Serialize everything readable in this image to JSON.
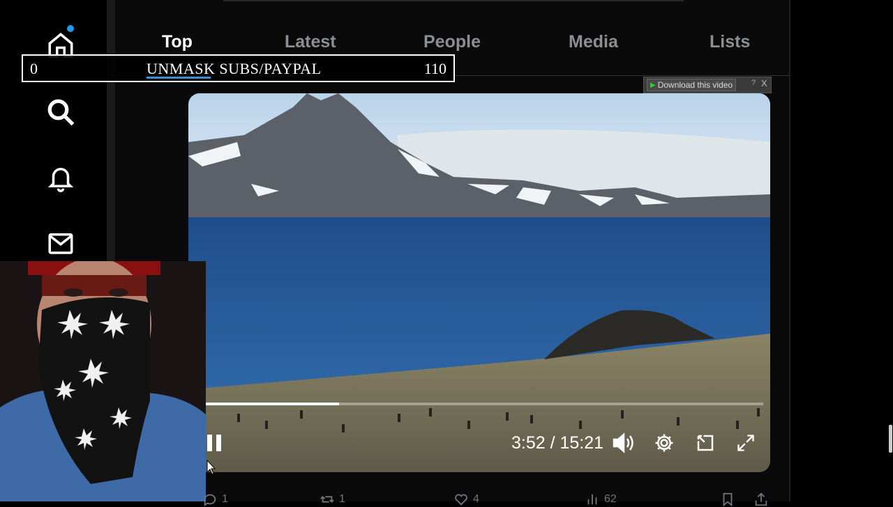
{
  "nav": {
    "items": [
      {
        "name": "home",
        "icon": "home-icon"
      },
      {
        "name": "search",
        "icon": "search-icon"
      },
      {
        "name": "notifications",
        "icon": "bell-icon"
      },
      {
        "name": "messages",
        "icon": "mail-icon"
      }
    ]
  },
  "tabs": [
    {
      "label": "Top",
      "active": true
    },
    {
      "label": "Latest",
      "active": false
    },
    {
      "label": "People",
      "active": false
    },
    {
      "label": "Media",
      "active": false
    },
    {
      "label": "Lists",
      "active": false
    }
  ],
  "ticker": {
    "left": "0",
    "center": "UNMASK SUBS/PAYPAL",
    "right": "110"
  },
  "download_bar": {
    "button": "Download this video",
    "help": "?",
    "close": "X"
  },
  "video": {
    "time": "3:52 / 15:21",
    "progress_fraction": 0.24,
    "controls": {
      "pause": "pause-icon",
      "volume": "volume-icon",
      "settings": "gear-icon",
      "pip": "pip-icon",
      "fullscreen": "fullscreen-icon"
    }
  },
  "tweet_actions": [
    {
      "icon": "reply-icon",
      "count": "1"
    },
    {
      "icon": "retweet-icon",
      "count": "1"
    },
    {
      "icon": "like-icon",
      "count": "4"
    },
    {
      "icon": "views-icon",
      "count": "62"
    }
  ],
  "colors": {
    "accent": "#1d9bf0",
    "background": "#000000"
  }
}
